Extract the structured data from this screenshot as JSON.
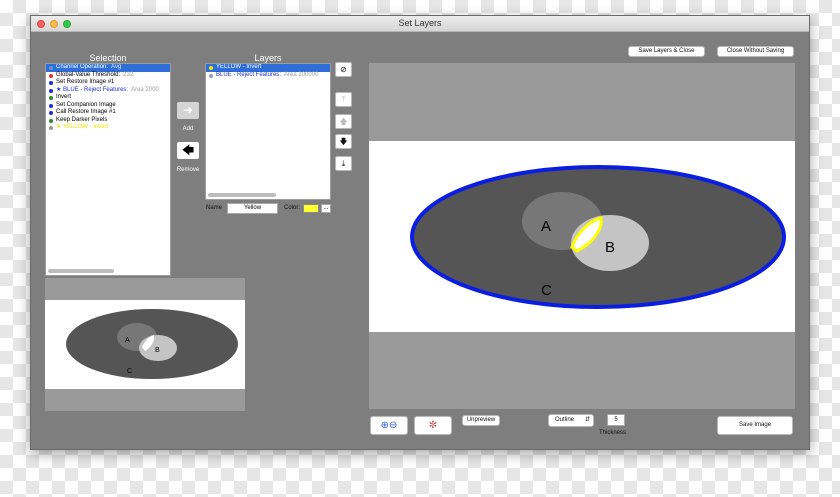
{
  "window": {
    "title": "Set Layers"
  },
  "selection": {
    "title": "Selection",
    "items": [
      {
        "label": "Channel Operation:",
        "detail": "Avg",
        "color": "#6a8fd8",
        "selected": true
      },
      {
        "label": "Global-Value Threshold:",
        "detail": "232",
        "color": "#e23030"
      },
      {
        "label": "Set Restore Image #1",
        "detail": "",
        "color": "#1e2fcf"
      },
      {
        "label": "★ BLUE - Reject Features:",
        "detail": "Area 2000",
        "color": "#1e2fcf",
        "textColor": "#1e2fcf"
      },
      {
        "label": "Invert",
        "detail": "",
        "color": "#2a8a2a"
      },
      {
        "label": "Set Companion Image",
        "detail": "",
        "color": "#1e2fcf"
      },
      {
        "label": "Call Restore Image #1",
        "detail": "",
        "color": "#1e2fcf"
      },
      {
        "label": "Keep Darker Pixels",
        "detail": "",
        "color": "#2a8a2a"
      },
      {
        "label": "★ YELLOW - Invert",
        "detail": "",
        "color": "#999999",
        "textColor": "#f2e500"
      }
    ]
  },
  "middle": {
    "add_label": "Add",
    "remove_label": "Remove",
    "add_icon": "arrow-right-icon",
    "remove_icon": "arrow-left-icon"
  },
  "layers": {
    "title": "Layers",
    "items": [
      {
        "label": "YELLOW - Invert",
        "detail": "",
        "color": "#f2e500",
        "selected": true
      },
      {
        "label": "BLUE - Reject Features:",
        "detail": "Area 200000",
        "color": "#9aa0b0",
        "textColor": "#1e2fcf"
      }
    ],
    "name_label": "Name",
    "name_value": "Yellow",
    "color_label": "Color:",
    "color_value": "#ffff33",
    "color_more": "...",
    "side_buttons": [
      "clear-icon",
      "move-top-icon",
      "move-up-icon",
      "move-down-icon",
      "move-bottom-icon"
    ]
  },
  "top_buttons": {
    "save_close": "Save Layers & Close",
    "close_without": "Close Without Saving"
  },
  "image": {
    "labels": {
      "a": "A",
      "b": "B",
      "c": "C"
    },
    "colors": {
      "background": "#ffffff",
      "ellipse": "#555555",
      "outline": "#0a1ee0",
      "circle_a": "#777777",
      "circle_b": "#c4c4c4",
      "overlap": "#ffff00"
    }
  },
  "bottom": {
    "zoom_icon": "zoom-in-out-icon",
    "color_wheel_icon": "color-wheel-icon",
    "unpreview": "Unpreview",
    "mode": "Outline",
    "thickness_value": "5",
    "thickness_label": "Thickness",
    "save_image": "Save Image"
  }
}
